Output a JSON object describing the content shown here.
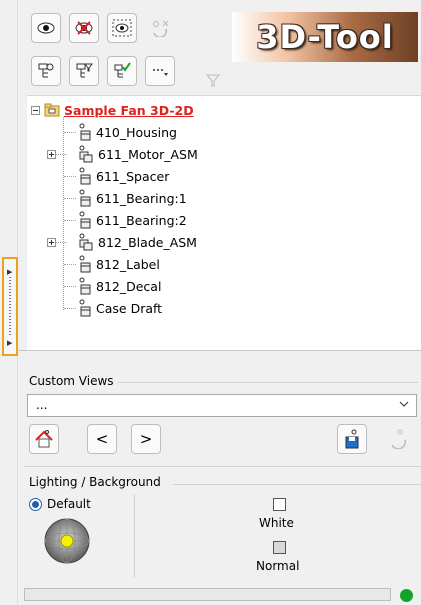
{
  "toolbar": {
    "row1": [
      {
        "icon": "eye-icon",
        "enabled": true
      },
      {
        "icon": "hide-icon",
        "enabled": true
      },
      {
        "icon": "show-selection-icon",
        "enabled": true
      },
      {
        "icon": "toggle-visibility-icon",
        "enabled": false
      }
    ],
    "row2": [
      {
        "icon": "tree-find-icon",
        "enabled": true
      },
      {
        "icon": "tree-filter-icon",
        "enabled": true
      },
      {
        "icon": "tree-check-icon",
        "enabled": true
      },
      {
        "icon": "more-dropdown-icon",
        "enabled": true
      },
      {
        "icon": "filter-icon",
        "enabled": false
      }
    ],
    "logo_text": "3D-Tool"
  },
  "tree": {
    "root": {
      "label": "Sample Fan  3D-2D",
      "expanded": true
    },
    "items": [
      {
        "label": "410_Housing",
        "type": "part",
        "expandable": false
      },
      {
        "label": "611_Motor_ASM",
        "type": "assembly",
        "expandable": true
      },
      {
        "label": "611_Spacer",
        "type": "part",
        "expandable": false
      },
      {
        "label": "611_Bearing:1",
        "type": "part",
        "expandable": false
      },
      {
        "label": "611_Bearing:2",
        "type": "part",
        "expandable": false
      },
      {
        "label": "812_Blade_ASM",
        "type": "assembly",
        "expandable": true
      },
      {
        "label": "812_Label",
        "type": "part",
        "expandable": false
      },
      {
        "label": "812_Decal",
        "type": "part",
        "expandable": false
      },
      {
        "label": "Case Draft",
        "type": "part",
        "expandable": false
      }
    ]
  },
  "custom_views": {
    "label": "Custom Views",
    "selected": "...",
    "buttons": [
      "home-view-icon",
      "previous-view-icon",
      "next-view-icon",
      "save-view-icon",
      "restore-view-icon"
    ],
    "prev_label": "<",
    "next_label": ">"
  },
  "lighting": {
    "label": "Lighting / Background",
    "default_label": "Default",
    "white_label": "White",
    "normal_label": "Normal"
  },
  "colors": {
    "root_label": "#e0221e",
    "highlight_border": "#f0a020",
    "status_ok": "#12a42a",
    "radio": "#1f5fb0"
  }
}
